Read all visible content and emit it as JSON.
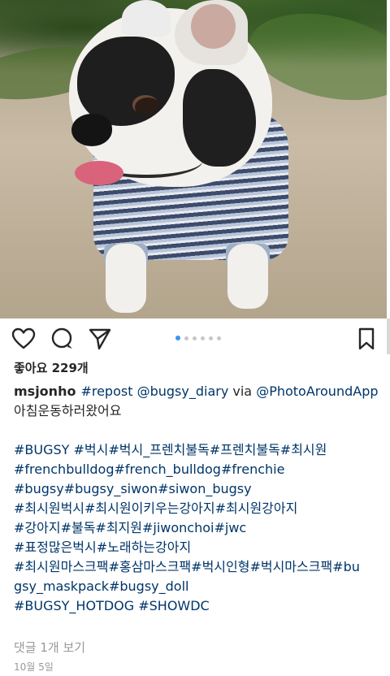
{
  "post": {
    "likes_label": "좋아요 229개",
    "username": "msjonho",
    "caption_parts": [
      "#repost",
      "@bugsy_diary",
      "via",
      "@PhotoAroundApp"
    ],
    "caption_line2": "아침운동하러왔어요",
    "hashtag_lines": [
      "#BUGSY #벅시#벅시_프렌치불독#프렌치불독#최시원",
      "#frenchbulldog#french_bulldog#frenchie",
      "#bugsy#bugsy_siwon#siwon_bugsy",
      "#최시원벅시#최시원이키우는강아지#최시원강아지",
      "#강아지#불독#최지원#jiwonchoi#jwc",
      "#표정많은벅시#노래하는강아지",
      "#최시원마스크팩#홍삼마스크팩#벅시인형#벅시마스크팩#bu",
      "gsy_maskpack#bugsy_doll",
      "#BUGSY_HOTDOG #SHOWDC"
    ],
    "comments_label": "댓글 1개 보기",
    "date_label": "10월 5일"
  },
  "carousel": {
    "count": 6,
    "active_index": 0,
    "active_color": "#3897f0"
  },
  "icons": [
    "heart-icon",
    "comment-icon",
    "share-icon",
    "bookmark-icon"
  ]
}
